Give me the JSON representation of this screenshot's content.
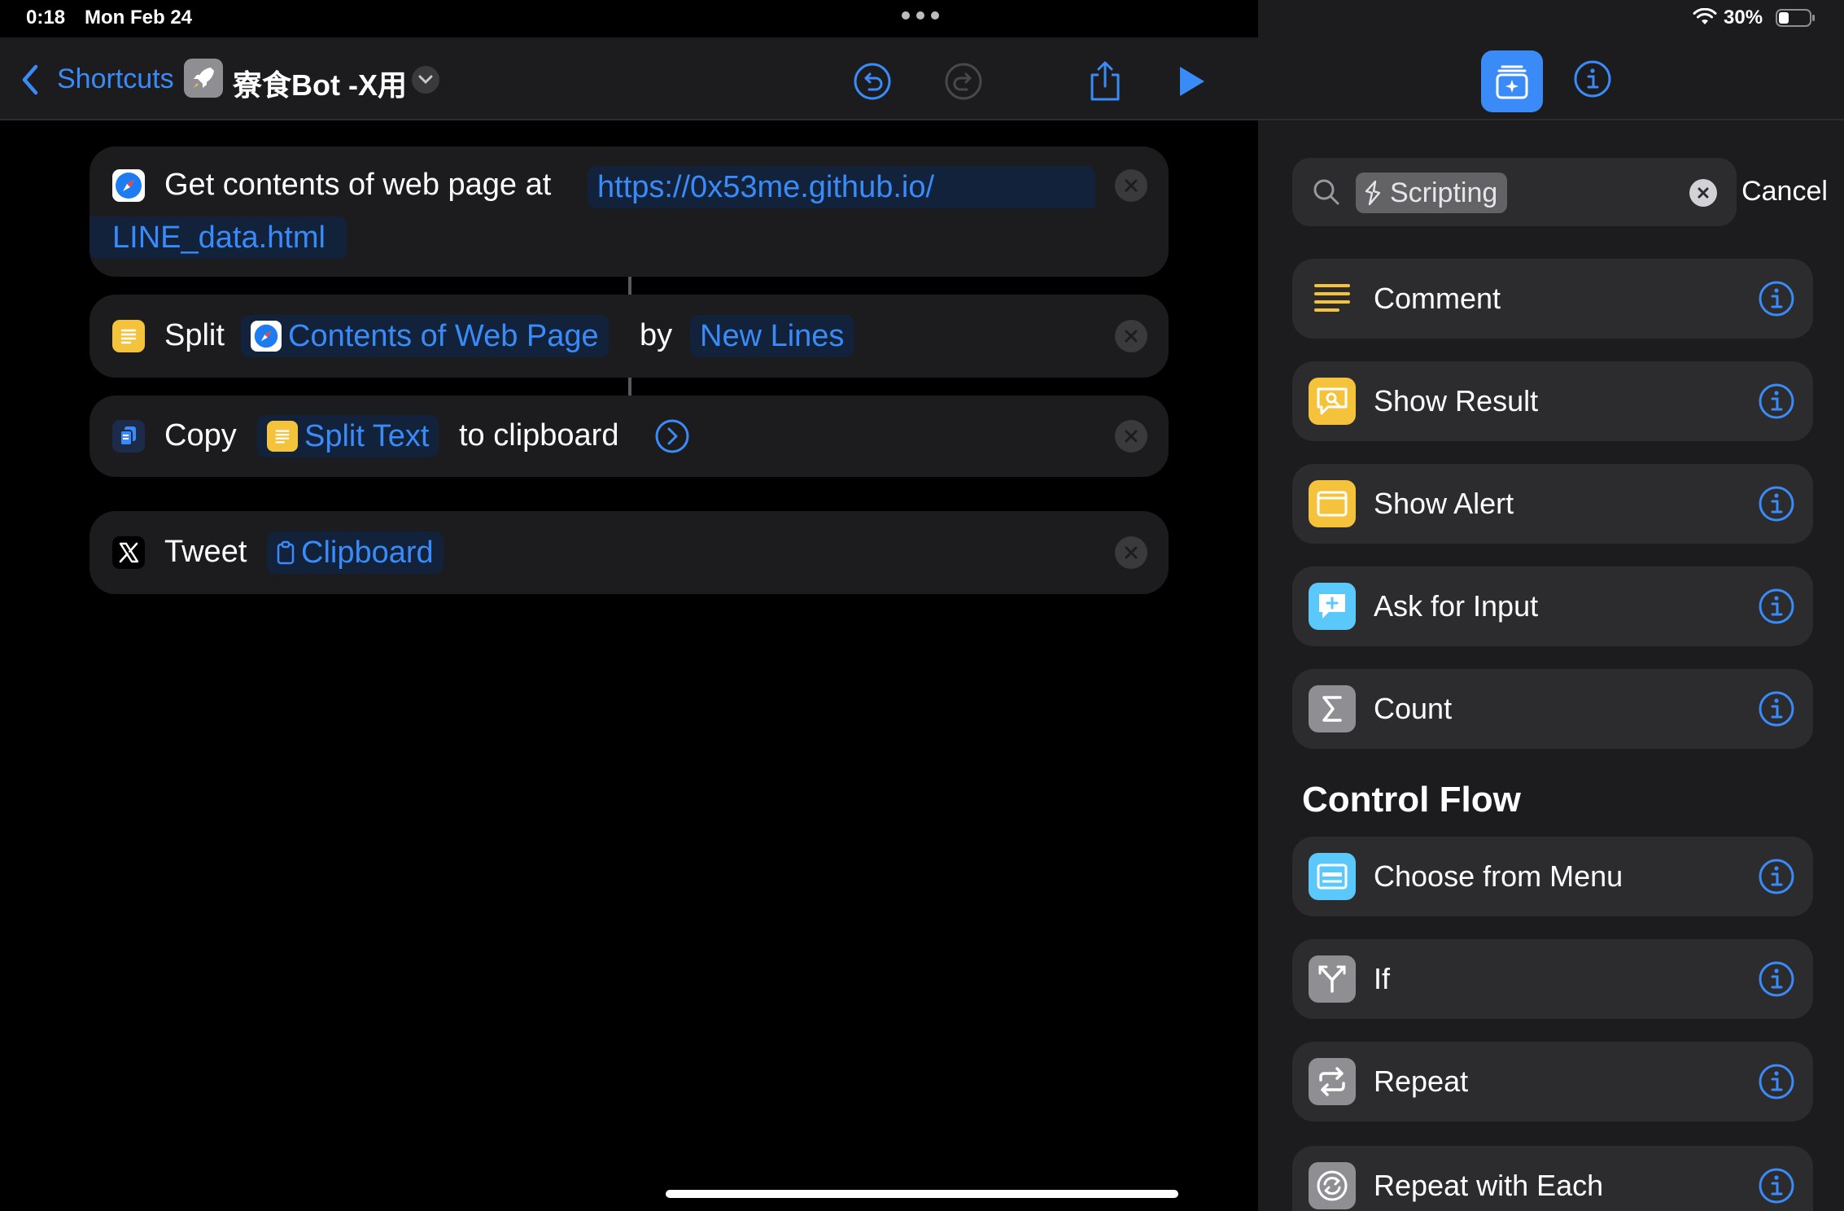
{
  "status_bar": {
    "time": "0:18",
    "date": "Mon Feb 24",
    "battery": "30%",
    "icons": [
      "wifi-icon",
      "battery-icon",
      "multitask-dots"
    ]
  },
  "toolbar": {
    "back_label": "Shortcuts",
    "shortcut_title": "寮食Bot -X用",
    "icons": [
      "back-chevron-icon",
      "rocket-icon",
      "chevron-down-icon",
      "undo-icon",
      "redo-icon",
      "share-icon",
      "play-icon"
    ]
  },
  "actions": [
    {
      "icon": "safari-icon",
      "text": "Get contents of web page at",
      "url_line1": "https://0x53me.github.io/",
      "url_line2": "LINE_data.html"
    },
    {
      "icon": "text-icon",
      "verb": "Split",
      "input_token": "Contents of Web Page",
      "by_label": "by",
      "separator_token": "New Lines"
    },
    {
      "icon": "copy-icon",
      "verb": "Copy",
      "input_token": "Split Text",
      "suffix": "to clipboard"
    },
    {
      "icon": "x-logo-icon",
      "verb": "Tweet",
      "input_token": "Clipboard"
    }
  ],
  "library": {
    "search": {
      "token": "Scripting",
      "cancel_label": "Cancel"
    },
    "scripting_items": [
      {
        "label": "Comment",
        "icon": "comment-lines-icon",
        "color": "#f5c33b"
      },
      {
        "label": "Show Result",
        "icon": "show-result-icon",
        "color": "#f5c33b"
      },
      {
        "label": "Show Alert",
        "icon": "alert-window-icon",
        "color": "#f5c33b"
      },
      {
        "label": "Ask for Input",
        "icon": "chat-plus-icon",
        "color": "#5ac8fa"
      },
      {
        "label": "Count",
        "icon": "sigma-icon",
        "color": "#8e8e93"
      }
    ],
    "section_title": "Control Flow",
    "control_flow_items": [
      {
        "label": "Choose from Menu",
        "icon": "menu-list-icon",
        "color": "#5ac8fa"
      },
      {
        "label": "If",
        "icon": "branch-icon",
        "color": "#8e8e93"
      },
      {
        "label": "Repeat",
        "icon": "repeat-icon",
        "color": "#8e8e93"
      },
      {
        "label": "Repeat with Each",
        "icon": "repeat-each-icon",
        "color": "#8e8e93"
      }
    ]
  },
  "colors": {
    "accent": "#3a8bf7",
    "card": "#1c1c1e",
    "token_bg": "#11223a"
  }
}
